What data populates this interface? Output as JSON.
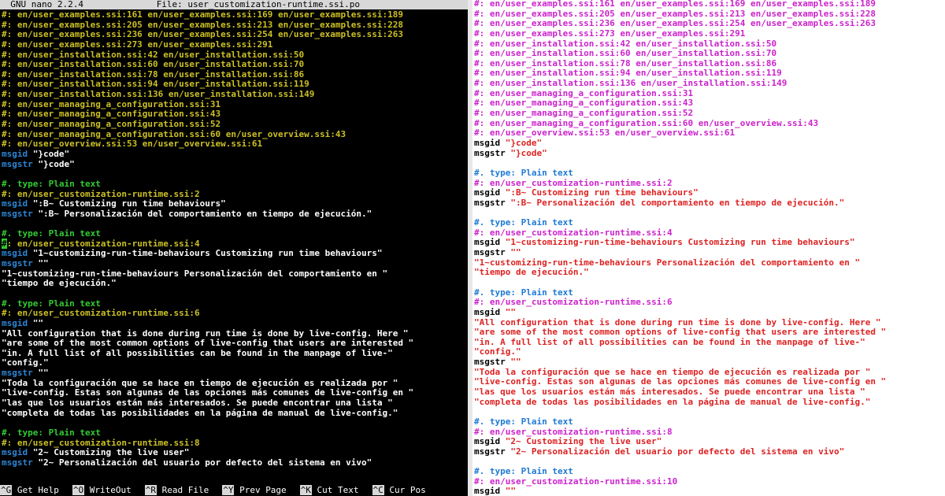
{
  "left_pane": {
    "title_bar": {
      "app": "GNU nano 2.2.4",
      "file": "File: user_customization-runtime.ssi.po"
    },
    "lines": [
      [
        {
          "c": "ref",
          "t": "#: en/user_examples.ssi:161 en/user_examples.ssi:169 en/user_examples.ssi:189"
        }
      ],
      [
        {
          "c": "ref",
          "t": "#: en/user_examples.ssi:205 en/user_examples.ssi:213 en/user_examples.ssi:228"
        }
      ],
      [
        {
          "c": "ref",
          "t": "#: en/user_examples.ssi:236 en/user_examples.ssi:254 en/user_examples.ssi:263"
        }
      ],
      [
        {
          "c": "ref",
          "t": "#: en/user_examples.ssi:273 en/user_examples.ssi:291"
        }
      ],
      [
        {
          "c": "ref",
          "t": "#: en/user_installation.ssi:42 en/user_installation.ssi:50"
        }
      ],
      [
        {
          "c": "ref",
          "t": "#: en/user_installation.ssi:60 en/user_installation.ssi:70"
        }
      ],
      [
        {
          "c": "ref",
          "t": "#: en/user_installation.ssi:78 en/user_installation.ssi:86"
        }
      ],
      [
        {
          "c": "ref",
          "t": "#: en/user_installation.ssi:94 en/user_installation.ssi:119"
        }
      ],
      [
        {
          "c": "ref",
          "t": "#: en/user_installation.ssi:136 en/user_installation.ssi:149"
        }
      ],
      [
        {
          "c": "ref",
          "t": "#: en/user_managing_a_configuration.ssi:31"
        }
      ],
      [
        {
          "c": "ref",
          "t": "#: en/user_managing_a_configuration.ssi:43"
        }
      ],
      [
        {
          "c": "ref",
          "t": "#: en/user_managing_a_configuration.ssi:52"
        }
      ],
      [
        {
          "c": "ref",
          "t": "#: en/user_managing_a_configuration.ssi:60 en/user_overview.ssi:43"
        }
      ],
      [
        {
          "c": "ref",
          "t": "#: en/user_overview.ssi:53 en/user_overview.ssi:61"
        }
      ],
      [
        {
          "c": "msgid",
          "t": "msgid "
        },
        {
          "c": "str",
          "t": "\"}code\""
        }
      ],
      [
        {
          "c": "msgid",
          "t": "msgstr "
        },
        {
          "c": "str",
          "t": "\"}code\""
        }
      ],
      [
        {
          "c": "plain",
          "t": ""
        }
      ],
      [
        {
          "c": "typec",
          "t": "#. type: Plain text"
        }
      ],
      [
        {
          "c": "ref",
          "t": "#: en/user_customization-runtime.ssi:2"
        }
      ],
      [
        {
          "c": "msgid",
          "t": "msgid "
        },
        {
          "c": "str",
          "t": "\":B~ Customizing run time behaviours\""
        }
      ],
      [
        {
          "c": "msgid",
          "t": "msgstr "
        },
        {
          "c": "str",
          "t": "\":B~ Personalización del comportamiento en tiempo de ejecución.\""
        }
      ],
      [
        {
          "c": "plain",
          "t": ""
        }
      ],
      [
        {
          "c": "typec",
          "t": "#. type: Plain text"
        }
      ],
      [
        {
          "c": "cursor",
          "t": "#"
        },
        {
          "c": "ref",
          "t": ": en/user_customization-runtime.ssi:4"
        }
      ],
      [
        {
          "c": "msgid",
          "t": "msgid "
        },
        {
          "c": "str",
          "t": "\"1~customizing-run-time-behaviours Customizing run time behaviours\""
        }
      ],
      [
        {
          "c": "msgid",
          "t": "msgstr "
        },
        {
          "c": "str",
          "t": "\"\""
        }
      ],
      [
        {
          "c": "str",
          "t": "\"1~customizing-run-time-behaviours Personalización del comportamiento en \""
        }
      ],
      [
        {
          "c": "str",
          "t": "\"tiempo de ejecución.\""
        }
      ],
      [
        {
          "c": "plain",
          "t": ""
        }
      ],
      [
        {
          "c": "typec",
          "t": "#. type: Plain text"
        }
      ],
      [
        {
          "c": "ref",
          "t": "#: en/user_customization-runtime.ssi:6"
        }
      ],
      [
        {
          "c": "msgid",
          "t": "msgid "
        },
        {
          "c": "str",
          "t": "\"\""
        }
      ],
      [
        {
          "c": "str",
          "t": "\"All configuration that is done during run time is done by live-config. Here \""
        }
      ],
      [
        {
          "c": "str",
          "t": "\"are some of the most common options of live-config that users are interested \""
        }
      ],
      [
        {
          "c": "str",
          "t": "\"in. A full list of all possibilities can be found in the manpage of live-\""
        }
      ],
      [
        {
          "c": "str",
          "t": "\"config.\""
        }
      ],
      [
        {
          "c": "msgid",
          "t": "msgstr "
        },
        {
          "c": "str",
          "t": "\"\""
        }
      ],
      [
        {
          "c": "str",
          "t": "\"Toda la configuración que se hace en tiempo de ejecución es realizada por \""
        }
      ],
      [
        {
          "c": "str",
          "t": "\"live-config. Estas son algunas de las opciones más comunes de live-config en \""
        }
      ],
      [
        {
          "c": "str",
          "t": "\"las que los usuarios están más interesados. Se puede encontrar una lista \""
        }
      ],
      [
        {
          "c": "str",
          "t": "\"completa de todas las posibilidades en la página de manual de live-config.\""
        }
      ],
      [
        {
          "c": "plain",
          "t": ""
        }
      ],
      [
        {
          "c": "typec",
          "t": "#. type: Plain text"
        }
      ],
      [
        {
          "c": "ref",
          "t": "#: en/user_customization-runtime.ssi:8"
        }
      ],
      [
        {
          "c": "msgid",
          "t": "msgid "
        },
        {
          "c": "str",
          "t": "\"2~ Customizing the live user\""
        }
      ],
      [
        {
          "c": "msgid",
          "t": "msgstr "
        },
        {
          "c": "str",
          "t": "\"2~ Personalización del usuario por defecto del sistema en vivo\""
        }
      ]
    ],
    "shortcuts": [
      {
        "key": "^G",
        "label": "Get Help"
      },
      {
        "key": "^O",
        "label": "WriteOut"
      },
      {
        "key": "^R",
        "label": "Read File"
      },
      {
        "key": "^Y",
        "label": "Prev Page"
      },
      {
        "key": "^K",
        "label": "Cut Text"
      },
      {
        "key": "^C",
        "label": "Cur Pos"
      }
    ]
  },
  "right_pane": {
    "lines": [
      [
        {
          "c": "ref",
          "t": "#: en/user_examples.ssi:161 en/user_examples.ssi:169 en/user_examples.ssi:189"
        }
      ],
      [
        {
          "c": "ref",
          "t": "#: en/user_examples.ssi:205 en/user_examples.ssi:213 en/user_examples.ssi:228"
        }
      ],
      [
        {
          "c": "ref",
          "t": "#: en/user_examples.ssi:236 en/user_examples.ssi:254 en/user_examples.ssi:263"
        }
      ],
      [
        {
          "c": "ref",
          "t": "#: en/user_examples.ssi:273 en/user_examples.ssi:291"
        }
      ],
      [
        {
          "c": "ref",
          "t": "#: en/user_installation.ssi:42 en/user_installation.ssi:50"
        }
      ],
      [
        {
          "c": "ref",
          "t": "#: en/user_installation.ssi:60 en/user_installation.ssi:70"
        }
      ],
      [
        {
          "c": "ref",
          "t": "#: en/user_installation.ssi:78 en/user_installation.ssi:86"
        }
      ],
      [
        {
          "c": "ref",
          "t": "#: en/user_installation.ssi:94 en/user_installation.ssi:119"
        }
      ],
      [
        {
          "c": "ref",
          "t": "#: en/user_installation.ssi:136 en/user_installation.ssi:149"
        }
      ],
      [
        {
          "c": "ref",
          "t": "#: en/user_managing_a_configuration.ssi:31"
        }
      ],
      [
        {
          "c": "ref",
          "t": "#: en/user_managing_a_configuration.ssi:43"
        }
      ],
      [
        {
          "c": "ref",
          "t": "#: en/user_managing_a_configuration.ssi:52"
        }
      ],
      [
        {
          "c": "ref",
          "t": "#: en/user_managing_a_configuration.ssi:60 en/user_overview.ssi:43"
        }
      ],
      [
        {
          "c": "ref",
          "t": "#: en/user_overview.ssi:53 en/user_overview.ssi:61"
        }
      ],
      [
        {
          "c": "msgid",
          "t": "msgid "
        },
        {
          "c": "str",
          "t": "\"}code\""
        }
      ],
      [
        {
          "c": "msgid",
          "t": "msgstr "
        },
        {
          "c": "str",
          "t": "\"}code\""
        }
      ],
      [
        {
          "c": "plain",
          "t": ""
        }
      ],
      [
        {
          "c": "typec",
          "t": "#. type: Plain text"
        }
      ],
      [
        {
          "c": "ref",
          "t": "#: en/user_customization-runtime.ssi:2"
        }
      ],
      [
        {
          "c": "msgid",
          "t": "msgid "
        },
        {
          "c": "str",
          "t": "\":B~ Customizing run time behaviours\""
        }
      ],
      [
        {
          "c": "msgid",
          "t": "msgstr "
        },
        {
          "c": "str",
          "t": "\":B~ Personalización del comportamiento en tiempo de ejecución.\""
        }
      ],
      [
        {
          "c": "plain",
          "t": ""
        }
      ],
      [
        {
          "c": "typec",
          "t": "#. type: Plain text"
        }
      ],
      [
        {
          "c": "ref",
          "t": "#: en/user_customization-runtime.ssi:4"
        }
      ],
      [
        {
          "c": "msgid",
          "t": "msgid "
        },
        {
          "c": "str",
          "t": "\"1~customizing-run-time-behaviours Customizing run time behaviours\""
        }
      ],
      [
        {
          "c": "msgid",
          "t": "msgstr "
        },
        {
          "c": "str",
          "t": "\"\""
        }
      ],
      [
        {
          "c": "str",
          "t": "\"1~customizing-run-time-behaviours Personalización del comportamiento en \""
        }
      ],
      [
        {
          "c": "str",
          "t": "\"tiempo de ejecución.\""
        }
      ],
      [
        {
          "c": "plain",
          "t": ""
        }
      ],
      [
        {
          "c": "typec",
          "t": "#. type: Plain text"
        }
      ],
      [
        {
          "c": "ref",
          "t": "#: en/user_customization-runtime.ssi:6"
        }
      ],
      [
        {
          "c": "msgid",
          "t": "msgid "
        },
        {
          "c": "str",
          "t": "\"\""
        }
      ],
      [
        {
          "c": "str",
          "t": "\"All configuration that is done during run time is done by live-config. Here \""
        }
      ],
      [
        {
          "c": "str",
          "t": "\"are some of the most common options of live-config that users are interested \""
        }
      ],
      [
        {
          "c": "str",
          "t": "\"in. A full list of all possibilities can be found in the manpage of live-\""
        }
      ],
      [
        {
          "c": "str",
          "t": "\"config.\""
        }
      ],
      [
        {
          "c": "msgid",
          "t": "msgstr "
        },
        {
          "c": "str",
          "t": "\"\""
        }
      ],
      [
        {
          "c": "str",
          "t": "\"Toda la configuración que se hace en tiempo de ejecución es realizada por \""
        }
      ],
      [
        {
          "c": "str",
          "t": "\"live-config. Estas son algunas de las opciones más comunes de live-config en \""
        }
      ],
      [
        {
          "c": "str",
          "t": "\"las que los usuarios están más interesados. Se puede encontrar una lista \""
        }
      ],
      [
        {
          "c": "str",
          "t": "\"completa de todas las posibilidades en la página de manual de live-config.\""
        }
      ],
      [
        {
          "c": "plain",
          "t": ""
        }
      ],
      [
        {
          "c": "typec",
          "t": "#. type: Plain text"
        }
      ],
      [
        {
          "c": "ref",
          "t": "#: en/user_customization-runtime.ssi:8"
        }
      ],
      [
        {
          "c": "msgid",
          "t": "msgid "
        },
        {
          "c": "str",
          "t": "\"2~ Customizing the live user\""
        }
      ],
      [
        {
          "c": "msgid",
          "t": "msgstr "
        },
        {
          "c": "str",
          "t": "\"2~ Personalización del usuario por defecto del sistema en vivo\""
        }
      ],
      [
        {
          "c": "plain",
          "t": ""
        }
      ],
      [
        {
          "c": "typec",
          "t": "#. type: Plain text"
        }
      ],
      [
        {
          "c": "ref",
          "t": "#: en/user_customization-runtime.ssi:10"
        }
      ],
      [
        {
          "c": "msgid",
          "t": "msgid "
        },
        {
          "c": "str",
          "t": "\"\""
        }
      ]
    ]
  },
  "colors": {
    "left_bg": "#000000",
    "right_bg": "#ffffff",
    "left_comment": "#33cc33",
    "left_ref": "#ccc026",
    "left_keyword": "#2d86d6",
    "right_ref": "#cc22cc",
    "right_type": "#1e7ad3",
    "right_string": "#dd2222"
  }
}
